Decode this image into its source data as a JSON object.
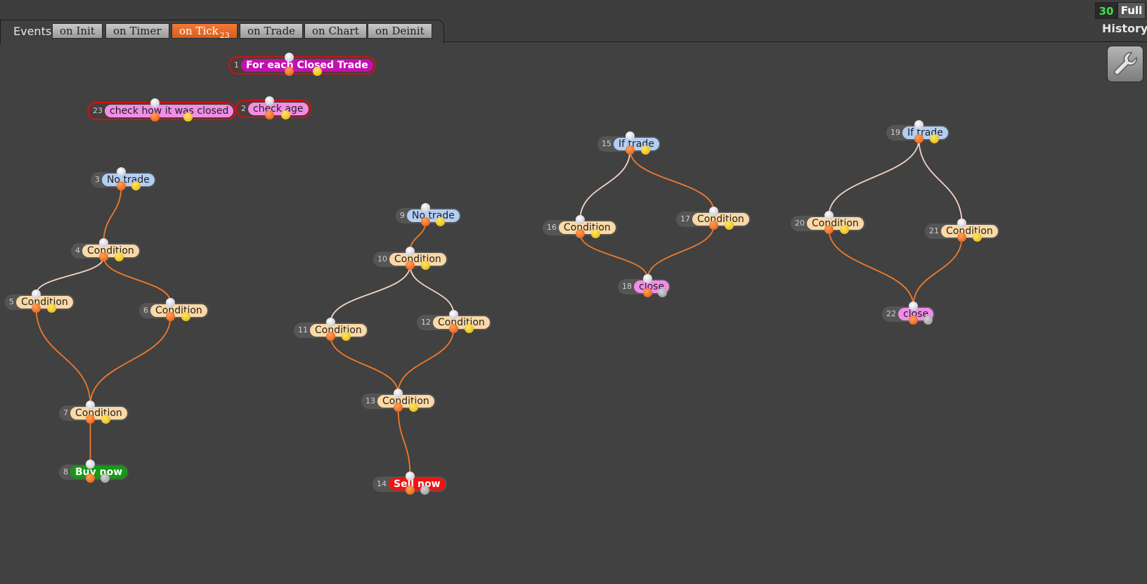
{
  "header": {
    "events_label": "Events",
    "tabs": [
      {
        "label": "on Init"
      },
      {
        "label": "on Timer"
      },
      {
        "label": "on Tick",
        "badge": "23",
        "active": true
      },
      {
        "label": "on Trade"
      },
      {
        "label": "on Chart"
      },
      {
        "label": "on Deinit"
      }
    ],
    "counter": "30",
    "full_label": "Full",
    "history_label": "History"
  },
  "colors": {
    "condition": "#fbd9a6",
    "if_block": "#b3cef4",
    "action": "#f08ee6",
    "loop": "#c410b0",
    "buy": "#139a16",
    "sell": "#ef1414",
    "selection": "#d21010",
    "wire_primary": "#f07a2a",
    "wire_secondary": "#f4d2c4"
  },
  "nodes": [
    {
      "id": "1",
      "label": "For each Closed Trade"
    },
    {
      "id": "2",
      "label": "check age"
    },
    {
      "id": "3",
      "label": "No trade"
    },
    {
      "id": "4",
      "label": "Condition"
    },
    {
      "id": "5",
      "label": "Condition"
    },
    {
      "id": "6",
      "label": "Condition"
    },
    {
      "id": "7",
      "label": "Condition"
    },
    {
      "id": "8",
      "label": "Buy now"
    },
    {
      "id": "9",
      "label": "No trade"
    },
    {
      "id": "10",
      "label": "Condition"
    },
    {
      "id": "11",
      "label": "Condition"
    },
    {
      "id": "12",
      "label": "Condition"
    },
    {
      "id": "13",
      "label": "Condition"
    },
    {
      "id": "14",
      "label": "Sell now"
    },
    {
      "id": "15",
      "label": "If trade"
    },
    {
      "id": "16",
      "label": "Condition"
    },
    {
      "id": "17",
      "label": "Condition"
    },
    {
      "id": "18",
      "label": "close"
    },
    {
      "id": "19",
      "label": "If trade"
    },
    {
      "id": "20",
      "label": "Condition"
    },
    {
      "id": "21",
      "label": "Condition"
    },
    {
      "id": "22",
      "label": "close"
    },
    {
      "id": "23",
      "label": "check how it was closed"
    }
  ],
  "links": [
    {
      "from": "3",
      "to": "4",
      "kind": "primary"
    },
    {
      "from": "4",
      "to": "5",
      "kind": "secondary"
    },
    {
      "from": "4",
      "to": "6",
      "kind": "primary"
    },
    {
      "from": "5",
      "to": "7",
      "kind": "primary"
    },
    {
      "from": "6",
      "to": "7",
      "kind": "primary"
    },
    {
      "from": "7",
      "to": "8",
      "kind": "primary"
    },
    {
      "from": "9",
      "to": "10",
      "kind": "primary"
    },
    {
      "from": "10",
      "to": "11",
      "kind": "secondary"
    },
    {
      "from": "10",
      "to": "12",
      "kind": "secondary"
    },
    {
      "from": "11",
      "to": "13",
      "kind": "primary"
    },
    {
      "from": "12",
      "to": "13",
      "kind": "primary"
    },
    {
      "from": "13",
      "to": "14",
      "kind": "primary"
    },
    {
      "from": "15",
      "to": "16",
      "kind": "secondary"
    },
    {
      "from": "15",
      "to": "17",
      "kind": "primary"
    },
    {
      "from": "16",
      "to": "18",
      "kind": "primary"
    },
    {
      "from": "17",
      "to": "18",
      "kind": "primary"
    },
    {
      "from": "19",
      "to": "20",
      "kind": "secondary"
    },
    {
      "from": "19",
      "to": "21",
      "kind": "secondary"
    },
    {
      "from": "20",
      "to": "22",
      "kind": "primary"
    },
    {
      "from": "21",
      "to": "22",
      "kind": "primary"
    }
  ]
}
